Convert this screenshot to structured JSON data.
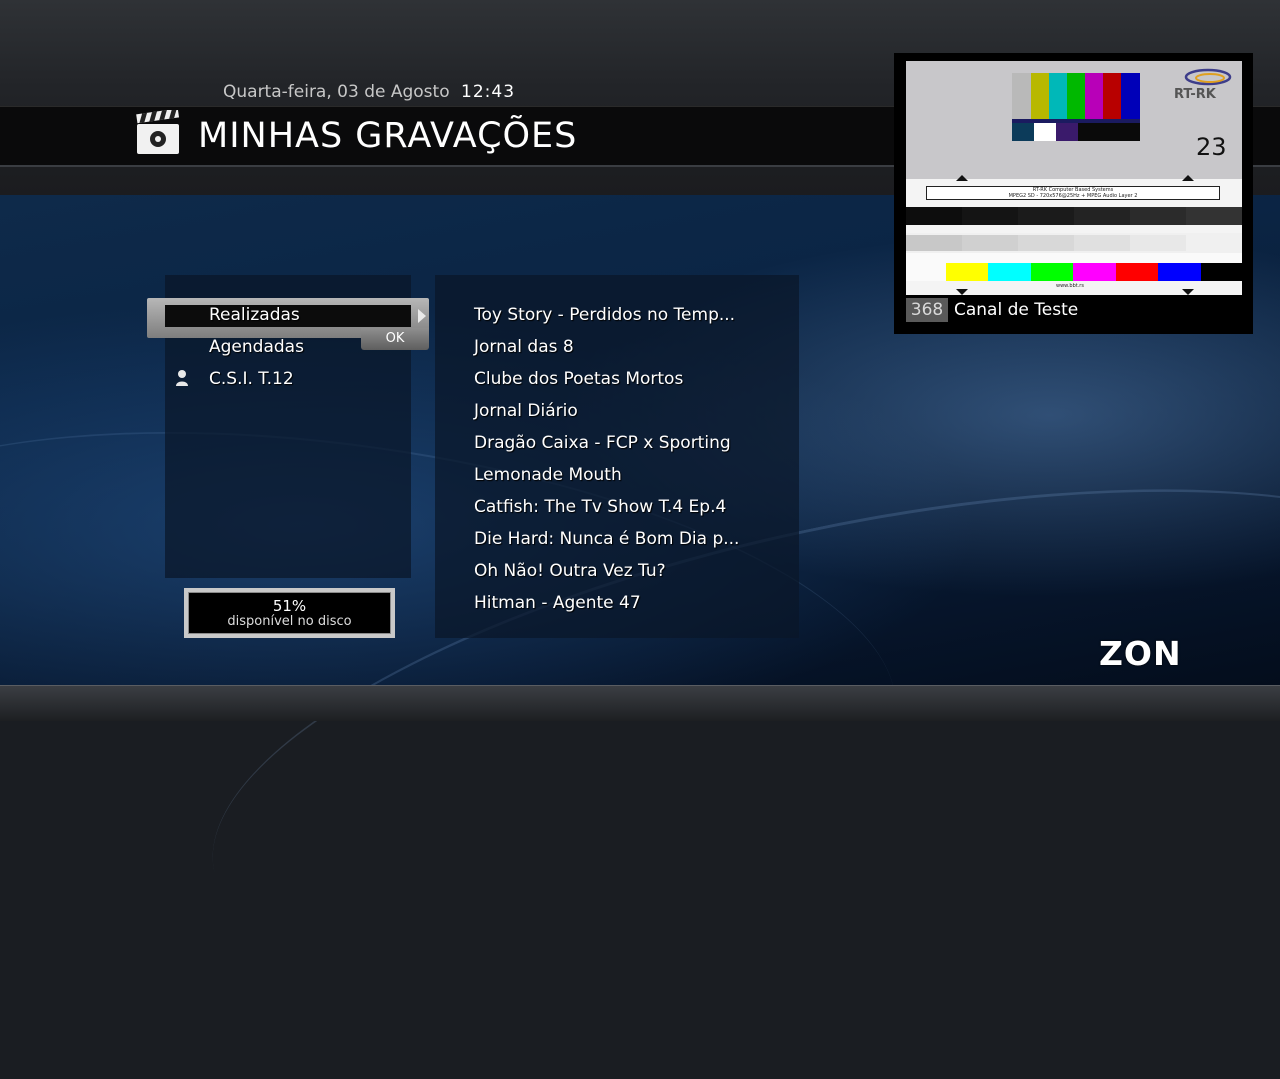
{
  "header": {
    "date": "Quarta-feira, 03 de Agosto",
    "time": "12:43",
    "title": "MINHAS GRAVAÇÕES",
    "title_icon": "clapperboard-icon"
  },
  "menu": {
    "items": [
      {
        "label": "Realizadas",
        "selected": true
      },
      {
        "label": "Agendadas",
        "selected": false
      },
      {
        "label": "C.S.I. T.12",
        "icon": "person-icon"
      }
    ],
    "ok_label": "OK"
  },
  "disk": {
    "percent": "51%",
    "label": "disponível no disco"
  },
  "recordings": [
    "Toy Story - Perdidos no Temp...",
    "Jornal das 8",
    "Clube dos Poetas Mortos",
    "Jornal Diário",
    "Dragão Caixa - FCP x Sporting",
    "Lemonade Mouth",
    "Catfish: The Tv Show T.4 Ep.4",
    "Die Hard: Nunca é Bom Dia p...",
    "Oh Não! Outra Vez Tu?",
    "Hitman - Agente 47"
  ],
  "preview": {
    "channel_number": "368",
    "channel_name": "Canal de Teste",
    "logo_text": "RT-RK",
    "test_number": "23",
    "caption_line1": "RT-RK Computer Based Systems",
    "caption_line2": "MPEG2 SD - 720x576@25Hz + MPEG Audio Layer 2",
    "footer_url": "www.bbt.rs"
  },
  "brand": {
    "logo": "ZON"
  },
  "colors": {
    "background_blue": "#0b2545",
    "title_strip": "#0a0a0b",
    "highlight_gray": "#9a9a9a"
  }
}
